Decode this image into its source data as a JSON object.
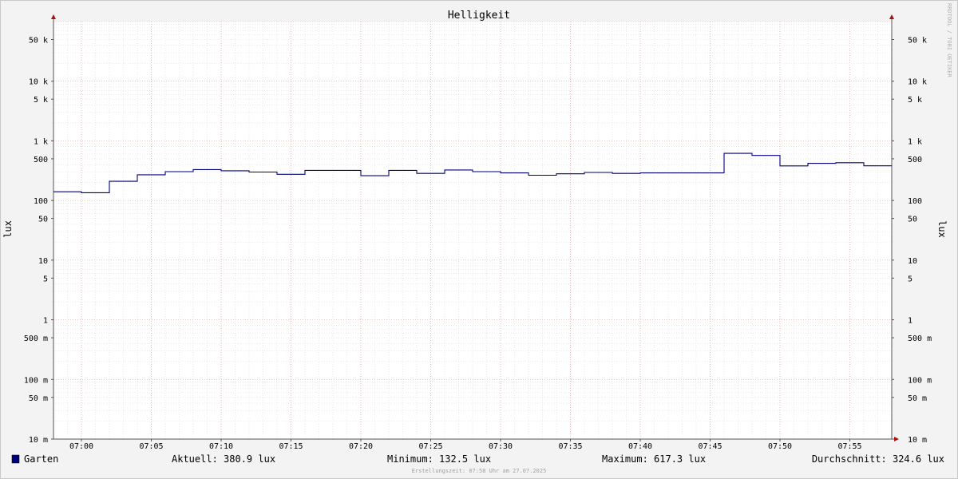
{
  "chart_data": {
    "type": "line",
    "title": "Helligkeit",
    "ylabel_left": "lux",
    "ylabel_right": "lux",
    "watermark": "RRDTOOL / TOBI OETIKER",
    "y_scale": "log",
    "ylim": [
      0.01,
      100000
    ],
    "y_ticks": [
      {
        "value": 50000,
        "label": "50 k"
      },
      {
        "value": 10000,
        "label": "10 k"
      },
      {
        "value": 5000,
        "label": "5 k"
      },
      {
        "value": 1000,
        "label": "1 k"
      },
      {
        "value": 500,
        "label": "500"
      },
      {
        "value": 100,
        "label": "100"
      },
      {
        "value": 50,
        "label": "50"
      },
      {
        "value": 10,
        "label": "10"
      },
      {
        "value": 5,
        "label": "5"
      },
      {
        "value": 1,
        "label": "1"
      },
      {
        "value": 0.5,
        "label": "500 m"
      },
      {
        "value": 0.1,
        "label": "100 m"
      },
      {
        "value": 0.05,
        "label": "50 m"
      },
      {
        "value": 0.01,
        "label": "10 m"
      }
    ],
    "x_range": [
      "06:58",
      "07:58"
    ],
    "x_ticks": [
      "07:00",
      "07:05",
      "07:10",
      "07:15",
      "07:20",
      "07:25",
      "07:30",
      "07:35",
      "07:40",
      "07:45",
      "07:50",
      "07:55"
    ],
    "grid": true,
    "series": [
      {
        "name": "Garten",
        "color": "#00007a",
        "x": [
          "06:58",
          "07:00",
          "07:02",
          "07:04",
          "07:06",
          "07:08",
          "07:10",
          "07:12",
          "07:14",
          "07:16",
          "07:18",
          "07:20",
          "07:22",
          "07:24",
          "07:26",
          "07:28",
          "07:30",
          "07:32",
          "07:34",
          "07:36",
          "07:38",
          "07:40",
          "07:42",
          "07:44",
          "07:46",
          "07:48",
          "07:50",
          "07:52",
          "07:54",
          "07:56"
        ],
        "values": [
          140,
          135,
          210,
          270,
          305,
          330,
          315,
          300,
          275,
          320,
          320,
          260,
          320,
          285,
          325,
          305,
          290,
          265,
          280,
          295,
          285,
          290,
          290,
          290,
          617.3,
          570,
          380,
          420,
          430,
          380.9
        ]
      }
    ]
  },
  "legend": {
    "name": "Garten",
    "color": "#00007a",
    "current": "Aktuell: 380.9 lux",
    "minimum": "Minimum: 132.5 lux",
    "maximum": "Maximum: 617.3 lux",
    "average": "Durchschnitt: 324.6 lux"
  },
  "footer": "Erstellungszeit: 07:58 Uhr am 27.07.2025"
}
